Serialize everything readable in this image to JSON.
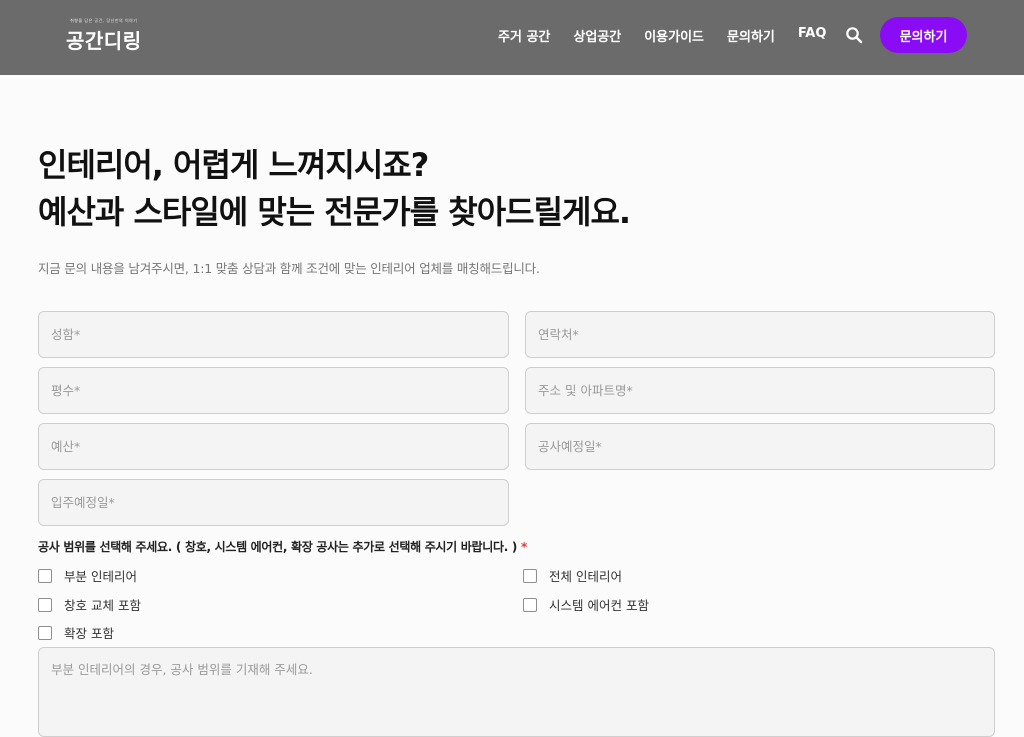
{
  "header": {
    "logo_tagline": "취향을 담은 공간, 당신만의 이야기",
    "logo_text": "공간디링",
    "nav": [
      "주거 공간",
      "상업공간",
      "이용가이드",
      "문의하기",
      "FAQ"
    ],
    "search_icon": "search-icon",
    "cta_label": "문의하기",
    "cta_color": "#8a0cf5",
    "header_bg": "#6b6b6b"
  },
  "hero": {
    "headline_line1": "인테리어, 어렵게 느껴지시죠?",
    "headline_line2": "예산과 스타일에 맞는 전문가를 찾아드릴게요.",
    "subtext": "지금 문의 내용을 남겨주시면, 1:1 맞춤 상담과 함께 조건에 맞는 인테리어 업체를 매칭해드립니다."
  },
  "form": {
    "name_placeholder": "성함*",
    "phone_placeholder": "연락처*",
    "area_placeholder": "평수*",
    "address_placeholder": "주소 및 아파트명*",
    "budget_placeholder": "예산*",
    "construction_date_placeholder": "공사예정일*",
    "movein_date_placeholder": "입주예정일*",
    "scope_label": "공사 범위를 선택해 주세요. ( 창호, 시스템 에어컨, 확장 공사는 추가로 선택해 주시기 바랍니다. )",
    "scope_required_mark": "*",
    "scope_options": [
      "부분 인테리어",
      "전체 인테리어",
      "창호 교체 포함",
      "시스템 에어컨 포함",
      "확장 포함"
    ],
    "details_placeholder": "부분 인테리어의 경우, 공사 범위를 기재해 주세요."
  }
}
